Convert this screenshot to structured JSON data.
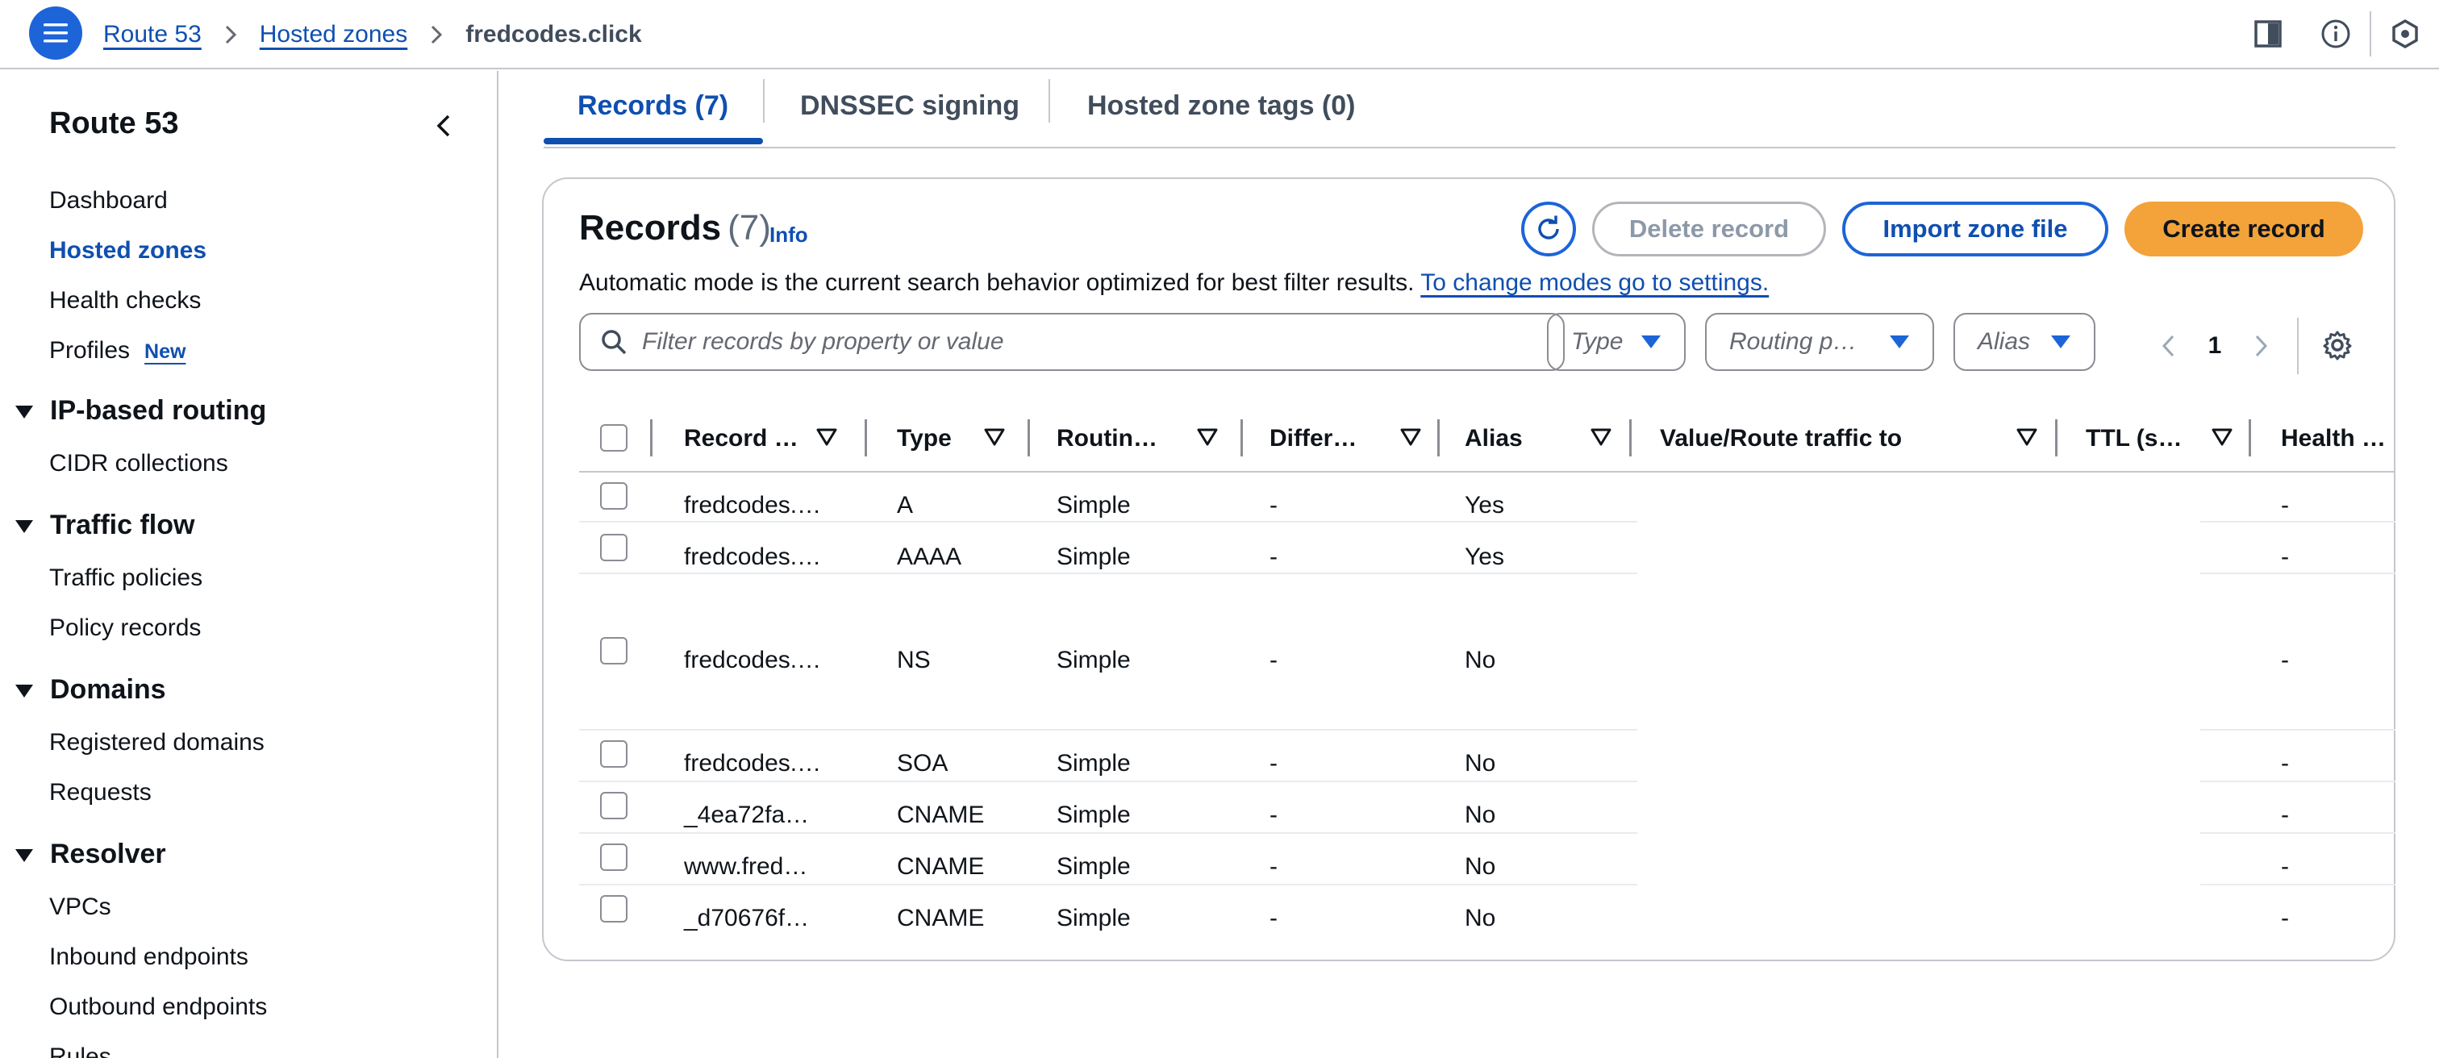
{
  "topbar": {
    "breadcrumb": [
      "Route 53",
      "Hosted zones"
    ],
    "current": "fredcodes.click"
  },
  "sidebar": {
    "title": "Route 53",
    "items_top": [
      {
        "label": "Dashboard",
        "active": false
      },
      {
        "label": "Hosted zones",
        "active": true
      },
      {
        "label": "Health checks",
        "active": false
      },
      {
        "label": "Profiles",
        "active": false,
        "badge": "New"
      }
    ],
    "sections": [
      {
        "title": "IP-based routing",
        "items": [
          "CIDR collections"
        ]
      },
      {
        "title": "Traffic flow",
        "items": [
          "Traffic policies",
          "Policy records"
        ]
      },
      {
        "title": "Domains",
        "items": [
          "Registered domains",
          "Requests"
        ]
      },
      {
        "title": "Resolver",
        "items": [
          "VPCs",
          "Inbound endpoints",
          "Outbound endpoints",
          "Rules"
        ]
      }
    ]
  },
  "tabs": [
    "Records (7)",
    "DNSSEC signing",
    "Hosted zone tags (0)"
  ],
  "records_panel": {
    "title": "Records",
    "count": "(7)",
    "info": "Info",
    "delete_label": "Delete record",
    "import_label": "Import zone file",
    "create_label": "Create record",
    "mode_text": "Automatic mode is the current search behavior optimized for best filter results.",
    "mode_link": "To change modes go to settings.",
    "search_placeholder": "Filter records by property or value",
    "filters": [
      "Type",
      "Routing p…",
      "Alias"
    ],
    "page": "1"
  },
  "table": {
    "columns": [
      "Record …",
      "Type",
      "Routin…",
      "Differ…",
      "Alias",
      "Value/Route traffic to",
      "TTL (s…",
      "Health …"
    ],
    "rows": [
      {
        "name": "fredcodes.…",
        "type": "A",
        "routing": "Simple",
        "differ": "-",
        "alias": "Yes",
        "value": "",
        "ttl": "",
        "health": "-"
      },
      {
        "name": "fredcodes.…",
        "type": "AAAA",
        "routing": "Simple",
        "differ": "-",
        "alias": "Yes",
        "value": "",
        "ttl": "",
        "health": "-"
      },
      {
        "name": "fredcodes.…",
        "type": "NS",
        "routing": "Simple",
        "differ": "-",
        "alias": "No",
        "value": "",
        "ttl": "",
        "health": "-"
      },
      {
        "name": "fredcodes.…",
        "type": "SOA",
        "routing": "Simple",
        "differ": "-",
        "alias": "No",
        "value": "",
        "ttl": "",
        "health": "-"
      },
      {
        "name": "_4ea72fa…",
        "type": "CNAME",
        "routing": "Simple",
        "differ": "-",
        "alias": "No",
        "value": "",
        "ttl": "",
        "health": "-"
      },
      {
        "name": "www.fred…",
        "type": "CNAME",
        "routing": "Simple",
        "differ": "-",
        "alias": "No",
        "value": "",
        "ttl": "",
        "health": "-"
      },
      {
        "name": "_d70676f…",
        "type": "CNAME",
        "routing": "Simple",
        "differ": "-",
        "alias": "No",
        "value": "",
        "ttl": "",
        "health": "-"
      }
    ]
  },
  "colors": {
    "link": "#0f4fb0",
    "primary_button": "#f3a33a",
    "accent": "#1c64d8"
  },
  "icons": [
    "menu-icon",
    "chevron-right-icon",
    "split-panel-icon",
    "info-circle-icon",
    "notifications-icon",
    "chevron-left-icon",
    "refresh-icon",
    "search-icon",
    "caret-down-icon",
    "sort-icon",
    "settings-icon",
    "triangle-down-icon"
  ]
}
